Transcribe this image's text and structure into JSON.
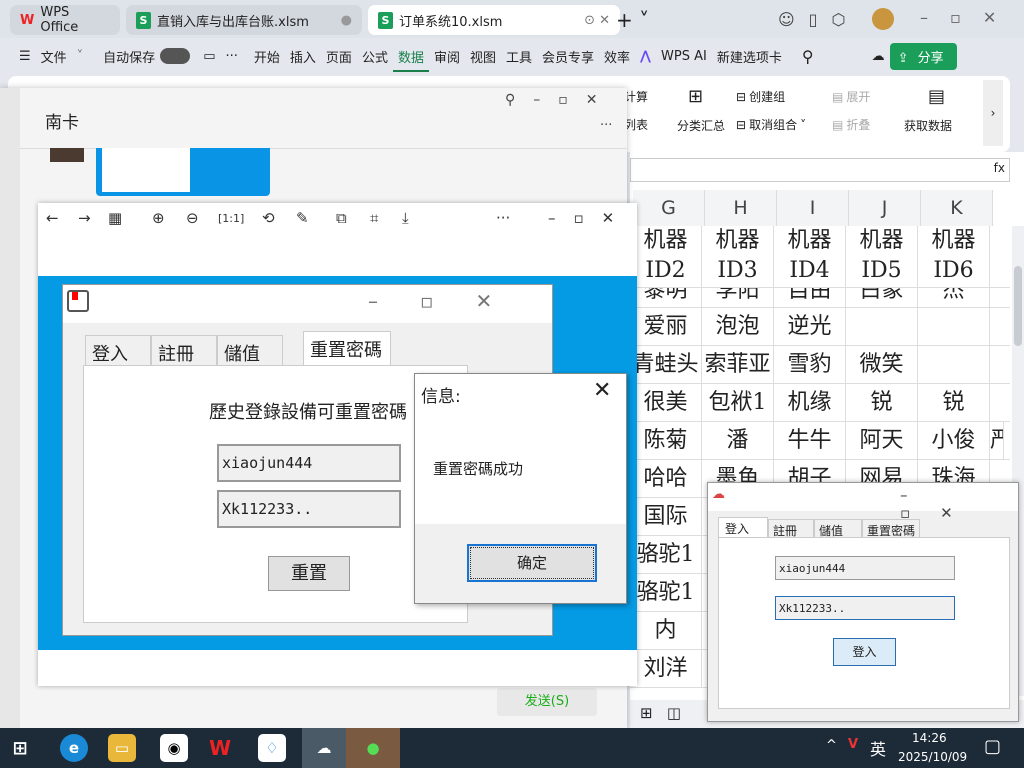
{
  "tabs": [
    {
      "label": "WPS Office"
    },
    {
      "label": "直销入库与出库台账.xlsm"
    },
    {
      "label": "订单系统10.xlsm"
    }
  ],
  "menu": {
    "file": "文件",
    "autosave": "自动保存",
    "items": [
      "开始",
      "插入",
      "页面",
      "公式",
      "数据",
      "审阅",
      "视图",
      "工具",
      "会员专享",
      "效率"
    ],
    "wps_ai": "WPS AI",
    "new_tab": "新建选项卡",
    "share": "分享"
  },
  "ribbon": {
    "calc": "计算",
    "list": "列表",
    "subtotal": "分类汇总",
    "create_group": "创建组",
    "ungroup": "取消组合",
    "expand": "展开",
    "collapse": "折叠",
    "get_data": "获取数据"
  },
  "sheet": {
    "columns": [
      "G",
      "H",
      "I",
      "J",
      "K"
    ],
    "header": [
      "机器\nID2",
      "机器\nID3",
      "机器\nID4",
      "机器\nID5",
      "机器\nID6"
    ],
    "rows": [
      [
        "黎明",
        "李阳",
        "自由",
        "白象",
        "杰"
      ],
      [
        "爱丽",
        "泡泡",
        "逆光",
        "",
        ""
      ],
      [
        "青蛙头",
        "索菲亚",
        "雪豹",
        "微笑",
        ""
      ],
      [
        "很美",
        "包袱1",
        "机缘",
        "锐",
        "锐"
      ],
      [
        "陈菊",
        "潘",
        "牛牛",
        "阿天",
        "小俊",
        "严"
      ],
      [
        "哈哈",
        "墨鱼",
        "胡子",
        "网易",
        "珠海"
      ],
      [
        "国际",
        "",
        "",
        "",
        ""
      ],
      [
        "骆驼1",
        "",
        "",
        "",
        ""
      ],
      [
        "骆驼1",
        "",
        "",
        "",
        ""
      ],
      [
        "内",
        "",
        "",
        "",
        ""
      ],
      [
        "刘洋",
        "",
        "",
        "",
        ""
      ]
    ]
  },
  "chat": {
    "title": "南卡",
    "send": "发送(S)"
  },
  "app": {
    "tabs": [
      "登入",
      "註冊",
      "儲值",
      "重置密碼"
    ],
    "heading": "歷史登錄設備可重置密碼",
    "username": "xiaojun444",
    "password": "Xk112233..",
    "reset": "重置"
  },
  "msgbox": {
    "title": "信息:",
    "message": "重置密碼成功",
    "ok": "确定"
  },
  "app2": {
    "tabs": [
      "登入",
      "註冊",
      "儲值",
      "重置密碼"
    ],
    "username": "xiaojun444",
    "password": "Xk112233..",
    "login": "登入"
  },
  "taskbar": {
    "ime": "英",
    "time": "14:26",
    "date": "2025/10/09"
  }
}
